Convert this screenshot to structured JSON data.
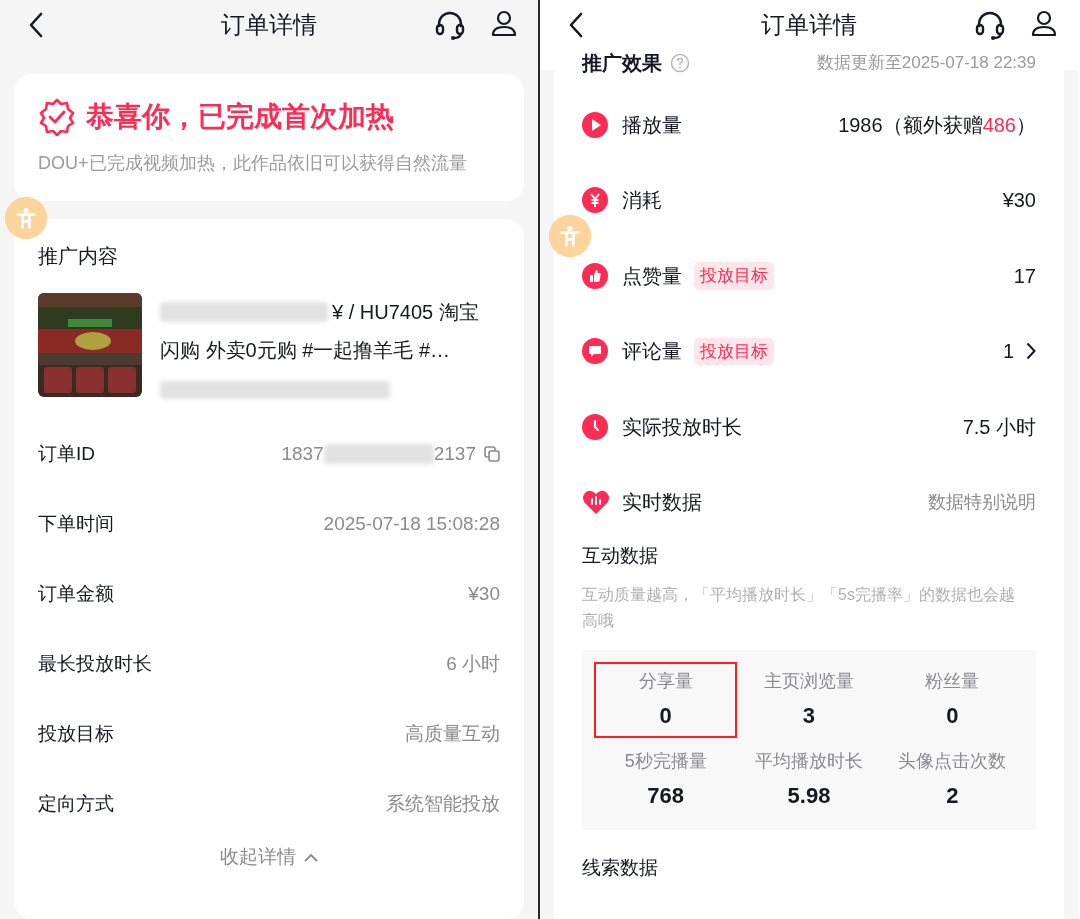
{
  "left": {
    "header": {
      "title": "订单详情"
    },
    "success": {
      "title": "恭喜你，已完成首次加热",
      "description": "DOU+已完成视频加热，此作品依旧可以获得自然流量"
    },
    "content": {
      "heading": "推广内容",
      "title_lines": [
        "¥ / HU7405 淘宝",
        "闪购 外卖0元购 #一起撸羊毛 #…"
      ]
    },
    "details": [
      {
        "label": "订单ID",
        "value": "1837",
        "value_end": "2137",
        "kind": "id"
      },
      {
        "label": "下单时间",
        "value": "2025-07-18 15:08:28",
        "kind": "plain"
      },
      {
        "label": "订单金额",
        "value": "¥30",
        "kind": "plain"
      },
      {
        "label": "最长投放时长",
        "value": "6 小时",
        "kind": "plain"
      },
      {
        "label": "投放目标",
        "value": "高质量互动",
        "kind": "plain"
      },
      {
        "label": "定向方式",
        "value": "系统智能投放",
        "kind": "plain"
      }
    ],
    "collapse": "收起详情"
  },
  "right": {
    "header": {
      "title": "订单详情"
    },
    "effect": {
      "heading": "推广效果",
      "updated": "数据更新至2025-07-18 22:39"
    },
    "metrics": [
      {
        "kind": "play",
        "label": "播放量",
        "value": "1986（额外获赠",
        "highlight": "486",
        "suffix": "）"
      },
      {
        "kind": "yen",
        "label": "消耗",
        "value": "¥30"
      },
      {
        "kind": "like",
        "label": "点赞量",
        "tag": "投放目标",
        "value": "17"
      },
      {
        "kind": "comment",
        "label": "评论量",
        "tag": "投放目标",
        "value": "1",
        "chevron": true
      },
      {
        "kind": "clock",
        "label": "实际投放时长",
        "value": "7.5 小时"
      }
    ],
    "realtime": {
      "label": "实时数据",
      "link": "数据特别说明"
    },
    "interaction": {
      "heading": "互动数据",
      "description": "互动质量越高，「平均播放时长」「5s完播率」的数据也会越高哦",
      "stats": [
        {
          "label": "分享量",
          "value": "0",
          "outlined": true
        },
        {
          "label": "主页浏览量",
          "value": "3",
          "outlined": false
        },
        {
          "label": "粉丝量",
          "value": "0",
          "outlined": false
        },
        {
          "label": "5秒完播量",
          "value": "768",
          "outlined": false
        },
        {
          "label": "平均播放时长",
          "value": "5.98",
          "outlined": false
        },
        {
          "label": "头像点击次数",
          "value": "2",
          "outlined": false
        }
      ]
    },
    "leads": {
      "heading": "线索数据"
    }
  }
}
